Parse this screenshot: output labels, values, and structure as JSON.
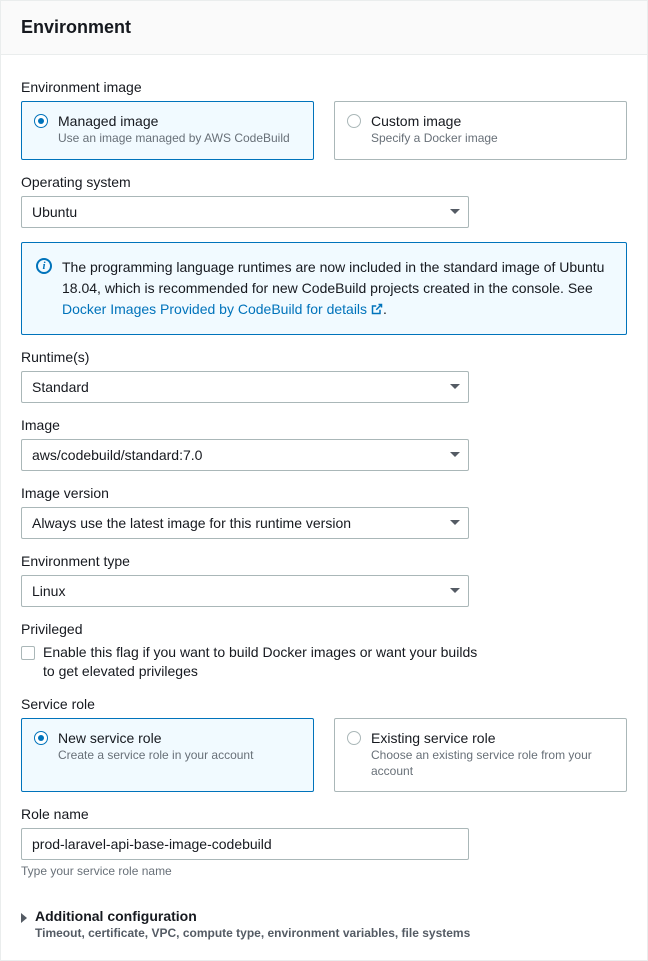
{
  "header": {
    "title": "Environment"
  },
  "env_image": {
    "label": "Environment image",
    "managed": {
      "title": "Managed image",
      "desc": "Use an image managed by AWS CodeBuild"
    },
    "custom": {
      "title": "Custom image",
      "desc": "Specify a Docker image"
    }
  },
  "os": {
    "label": "Operating system",
    "value": "Ubuntu"
  },
  "info": {
    "text_before": "The programming language runtimes are now included in the standard image of Ubuntu 18.04, which is recommended for new CodeBuild projects created in the console. See ",
    "link": "Docker Images Provided by CodeBuild for details",
    "text_after": "."
  },
  "runtime": {
    "label": "Runtime(s)",
    "value": "Standard"
  },
  "image": {
    "label": "Image",
    "value": "aws/codebuild/standard:7.0"
  },
  "image_version": {
    "label": "Image version",
    "value": "Always use the latest image for this runtime version"
  },
  "env_type": {
    "label": "Environment type",
    "value": "Linux"
  },
  "privileged": {
    "label": "Privileged",
    "desc": "Enable this flag if you want to build Docker images or want your builds to get elevated privileges"
  },
  "service_role": {
    "label": "Service role",
    "new": {
      "title": "New service role",
      "desc": "Create a service role in your account"
    },
    "existing": {
      "title": "Existing service role",
      "desc": "Choose an existing service role from your account"
    }
  },
  "role_name": {
    "label": "Role name",
    "value": "prod-laravel-api-base-image-codebuild",
    "hint": "Type your service role name"
  },
  "additional": {
    "title": "Additional configuration",
    "desc": "Timeout, certificate, VPC, compute type, environment variables, file systems"
  }
}
